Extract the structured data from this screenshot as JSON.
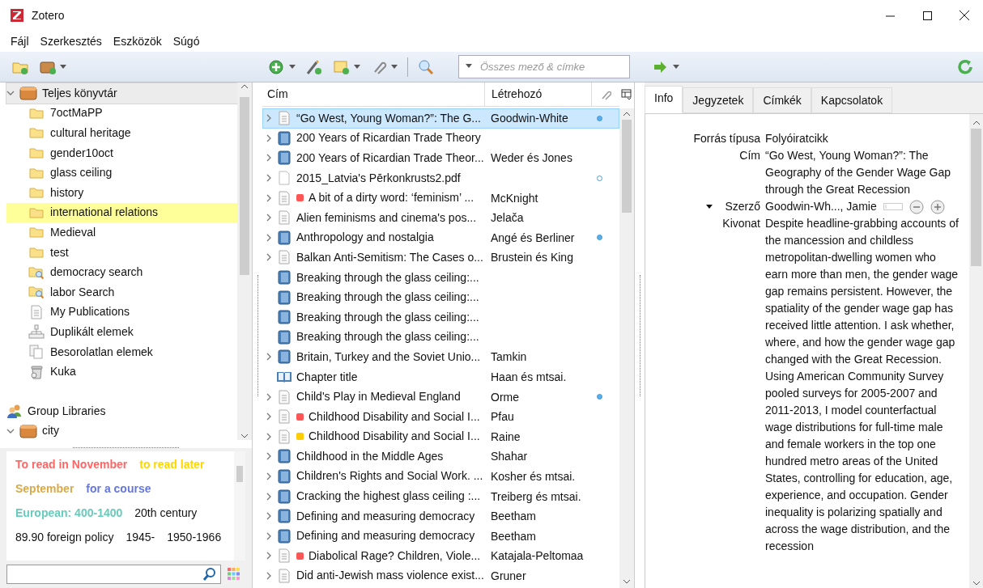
{
  "window": {
    "title": "Zotero"
  },
  "menu": [
    "Fájl",
    "Szerkesztés",
    "Eszközök",
    "Súgó"
  ],
  "search": {
    "placeholder": "Összes mező & címke"
  },
  "collections": [
    {
      "label": "Teljes könyvtár",
      "kind": "library",
      "selected": true,
      "highlighted": false,
      "expanded": true,
      "children": [
        {
          "label": "7octMaPP",
          "kind": "folder",
          "selected": false,
          "highlighted": false
        },
        {
          "label": "cultural heritage",
          "kind": "folder",
          "selected": false,
          "highlighted": false
        },
        {
          "label": "gender10oct",
          "kind": "folder",
          "selected": false,
          "highlighted": false
        },
        {
          "label": "glass ceiling",
          "kind": "folder",
          "selected": false,
          "highlighted": false
        },
        {
          "label": "history",
          "kind": "folder",
          "selected": false,
          "highlighted": false
        },
        {
          "label": "international relations",
          "kind": "folder",
          "selected": false,
          "highlighted": true
        },
        {
          "label": "Medieval",
          "kind": "folder",
          "selected": false,
          "highlighted": false
        },
        {
          "label": "test",
          "kind": "folder",
          "selected": false,
          "highlighted": false
        },
        {
          "label": "democracy search",
          "kind": "search",
          "selected": false,
          "highlighted": false
        },
        {
          "label": "labor Search",
          "kind": "search",
          "selected": false,
          "highlighted": false
        },
        {
          "label": "My Publications",
          "kind": "publications",
          "selected": false,
          "highlighted": false
        },
        {
          "label": "Duplikált elemek",
          "kind": "duplicates",
          "selected": false,
          "highlighted": false
        },
        {
          "label": "Besorolatlan elemek",
          "kind": "unfiled",
          "selected": false,
          "highlighted": false
        },
        {
          "label": "Kuka",
          "kind": "trash",
          "selected": false,
          "highlighted": false
        }
      ]
    }
  ],
  "group_libraries": {
    "label": "Group Libraries",
    "libraries": [
      {
        "label": "city",
        "kind": "library",
        "selected": false,
        "highlighted": false,
        "expanded": true
      }
    ]
  },
  "tags": [
    {
      "label": "To read in November",
      "color": "#ff6666"
    },
    {
      "label": "to read later",
      "color": "#ffd700"
    },
    {
      "label": "September",
      "color": "#d9a94a"
    },
    {
      "label": "for a course",
      "color": "#6677dd"
    },
    {
      "label": "European: 400-1400",
      "color": "#66ccbb"
    },
    {
      "label": "20th century"
    },
    {
      "label": "89.90 foreign policy"
    },
    {
      "label": "1945-"
    },
    {
      "label": "1950-1966"
    }
  ],
  "items_table": {
    "columns": [
      "Cím",
      "Létrehozó"
    ],
    "rows": [
      {
        "title": "“Go West, Young Woman?”: The G...",
        "creator": "Goodwin-White",
        "kind": "document",
        "has_children": true,
        "has_attachment": true,
        "attachment_available": true,
        "selected": true
      },
      {
        "title": "200 Years of Ricardian Trade Theory",
        "kind": "book",
        "has_children": true,
        "selected": false
      },
      {
        "title": "200 Years of Ricardian Trade Theor...",
        "creator": "Weder és Jones",
        "kind": "book",
        "has_children": true,
        "selected": false
      },
      {
        "title": "2015_Latvia's Pērkonkrusts2.pdf",
        "kind": "file",
        "has_children": true,
        "has_attachment": true,
        "attachment_available": false,
        "selected": false
      },
      {
        "title": "A bit of a dirty word: ‘feminism’ ...",
        "creator": "McKnight",
        "kind": "document",
        "has_children": true,
        "color": "#ff5555",
        "selected": false
      },
      {
        "title": "Alien feminisms and cinema's pos...",
        "creator": "Jelača",
        "kind": "document",
        "has_children": true,
        "selected": false
      },
      {
        "title": "Anthropology and nostalgia",
        "creator": "Angé és Berliner",
        "kind": "book",
        "has_children": true,
        "has_attachment": true,
        "attachment_available": true,
        "selected": false
      },
      {
        "title": "Balkan Anti-Semitism: The Cases o...",
        "creator": "Brustein és King",
        "kind": "document",
        "has_children": true,
        "selected": false
      },
      {
        "title": "Breaking through the glass ceiling:...",
        "kind": "book",
        "has_children": false,
        "selected": false
      },
      {
        "title": "Breaking through the glass ceiling:...",
        "kind": "book",
        "has_children": false,
        "selected": false
      },
      {
        "title": "Breaking through the glass ceiling:...",
        "kind": "book",
        "has_children": false,
        "selected": false
      },
      {
        "title": "Breaking through the glass ceiling:...",
        "kind": "book",
        "has_children": false,
        "selected": false
      },
      {
        "title": "Britain, Turkey and the Soviet Unio...",
        "creator": "Tamkin",
        "kind": "book",
        "has_children": true,
        "selected": false
      },
      {
        "title": "Chapter title",
        "creator": "Haan és mtsai.",
        "kind": "chapter",
        "has_children": false,
        "selected": false
      },
      {
        "title": "Child's Play in Medieval England",
        "creator": "Orme",
        "kind": "document",
        "has_children": true,
        "has_attachment": true,
        "attachment_available": true,
        "selected": false
      },
      {
        "title": "Childhood Disability and Social I...",
        "creator": "Pfau",
        "kind": "document",
        "has_children": true,
        "color": "#ff5555",
        "selected": false
      },
      {
        "title": "Childhood Disability and Social I...",
        "creator": "Raine",
        "kind": "document",
        "has_children": true,
        "color": "#ffcc00",
        "selected": false
      },
      {
        "title": "Childhood in the Middle Ages",
        "creator": "Shahar",
        "kind": "book",
        "has_children": true,
        "selected": false
      },
      {
        "title": "Children's Rights and Social Work. ...",
        "creator": "Kosher és mtsai.",
        "kind": "book",
        "has_children": true,
        "selected": false
      },
      {
        "title": "Cracking the highest glass ceiling :...",
        "creator": "Treiberg és mtsai.",
        "kind": "book",
        "has_children": true,
        "selected": false
      },
      {
        "title": "Defining and measuring democracy",
        "creator": "Beetham",
        "kind": "book",
        "has_children": true,
        "selected": false
      },
      {
        "title": "Defining and measuring democracy",
        "creator": "Beetham",
        "kind": "book",
        "has_children": true,
        "selected": false
      },
      {
        "title": "Diabolical Rage? Children, Viole...",
        "creator": "Katajala-Peltomaa",
        "kind": "document",
        "has_children": true,
        "color": "#ff5555",
        "selected": false
      },
      {
        "title": "Did anti-Jewish mass violence exist...",
        "creator": "Gruner",
        "kind": "document",
        "has_children": true,
        "selected": false
      }
    ]
  },
  "item_pane": {
    "tabs": [
      {
        "label": "Info",
        "selected": true
      },
      {
        "label": "Jegyzetek",
        "selected": false
      },
      {
        "label": "Címkék",
        "selected": false
      },
      {
        "label": "Kapcsolatok",
        "selected": false
      }
    ],
    "fields": [
      {
        "label": "Forrás típusa",
        "value": "Folyóiratcikk",
        "kind": "text"
      },
      {
        "label": "Cím",
        "value": "“Go West, Young Woman?”: The Geography of the Gender Wage Gap through the Great Recession",
        "kind": "text"
      },
      {
        "label": "Szerző",
        "value": "Goodwin-Wh..., Jamie",
        "kind": "creator"
      },
      {
        "label": "Kivonat",
        "value": "Despite headline-grabbing accounts of the mancession and childless metropolitan-dwelling women who earn more than men, the gender wage gap remains persistent. However, the spatiality of the gender wage gap has received little attention. I ask whether, where, and how the gender wage gap changed with the Great Recession. Using American Community Survey pooled surveys for 2005-2007 and 2011-2013, I model counterfactual wage distributions for full-time male and female workers in the top one hundred metro areas of the United States, controlling for education, age, experience, and occupation. Gender inequality is polarizing spatially and across the wage distribution, and the recession",
        "kind": "text"
      }
    ]
  }
}
